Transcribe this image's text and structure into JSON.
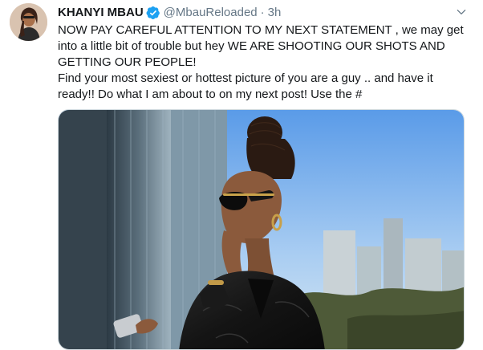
{
  "tweet": {
    "author_name": "KHANYI MBAU",
    "handle": "@MbauReloaded",
    "separator": "·",
    "time": "3h",
    "paragraph_1": "NOW PAY CAREFUL ATTENTION TO MY NEXT STATEMENT , we may get into a little bit of trouble but hey WE ARE SHOOTING OUR SHOTS AND GETTING OUR PEOPLE!",
    "paragraph_2": "Find your most sexiest or hottest picture of you are a guy .. and have it ready!! Do what I am about to on my next post! Use the #",
    "verified": true
  },
  "icons": {
    "verified": "verified-badge-icon",
    "more": "chevron-down-icon"
  },
  "colors": {
    "verified_blue": "#1da1f2",
    "secondary_text": "#657786",
    "primary_text": "#14171a"
  }
}
